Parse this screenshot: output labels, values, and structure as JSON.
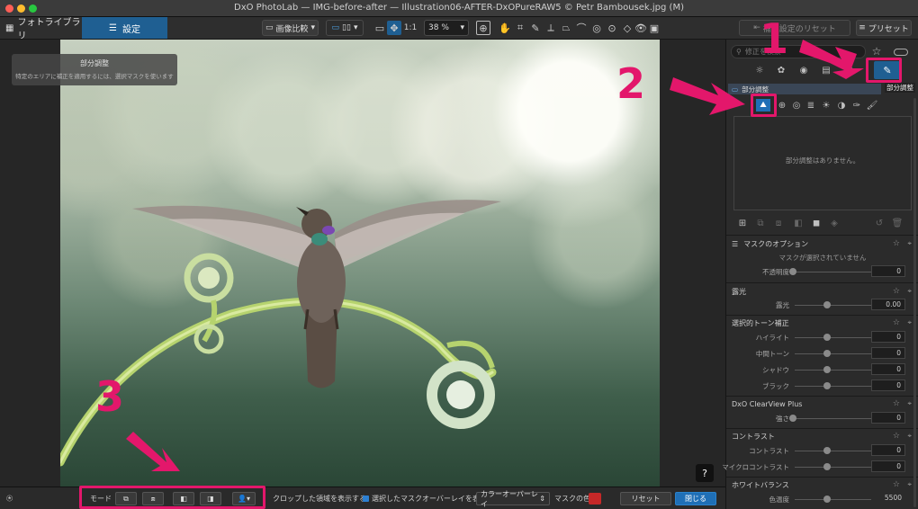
{
  "window": {
    "title": "DxO PhotoLab — IMG-before-after — Illustration06-AFTER-DxOPureRAW5 © Petr Bambousek.jpg (M)"
  },
  "tabs": {
    "library": "フォトライブラリ",
    "settings": "設定"
  },
  "toolbar": {
    "compare_label": "画像比較",
    "ratio_label": "1:1",
    "zoom_value": "38 %",
    "reset_corrections_label": "補正設定のリセット",
    "presets_label": "プリセット"
  },
  "mask_panel": {
    "title": "部分調整",
    "description": "特定のエリアに補正を適用するには、選択マスクを使います"
  },
  "help": "?",
  "right_panel": {
    "search_placeholder": "修正を検索",
    "active_tab_tooltip": "部分調整",
    "local_header": "部分調整",
    "empty_message": "部分調整はありません。",
    "mask_options": {
      "title": "マスクのオプション",
      "no_selection": "マスクが選択されていません",
      "opacity_label": "不透明度",
      "opacity_value": "0"
    },
    "exposure": {
      "title": "露光",
      "label": "露光",
      "value": "0.00"
    },
    "selective_tone": {
      "title": "選択的トーン補正",
      "items": [
        {
          "label": "ハイライト",
          "value": "0"
        },
        {
          "label": "中間トーン",
          "value": "0"
        },
        {
          "label": "シャドウ",
          "value": "0"
        },
        {
          "label": "ブラック",
          "value": "0"
        }
      ]
    },
    "clearview": {
      "title": "DxO ClearView Plus",
      "label": "強さ",
      "value": "0"
    },
    "contrast": {
      "title": "コントラスト",
      "items": [
        {
          "label": "コントラスト",
          "value": "0"
        },
        {
          "label": "マイクロコントラスト",
          "value": "0"
        }
      ]
    },
    "white_balance": {
      "title": "ホワイトバランス",
      "label": "色温度",
      "value": "5500"
    }
  },
  "bottom_bar": {
    "mode_label": "モード",
    "crop_label": "クロップした領域を表示する",
    "overlay_label": "選択したマスクオーバーレイを表示",
    "overlay_type": "カラーオーバーレイ",
    "mask_color_label": "マスクの色",
    "mask_color": "#c62828",
    "reset_label": "リセット",
    "close_label": "閉じる"
  },
  "annotations": {
    "n1": "1",
    "n2": "2",
    "n3": "3",
    "color": "#e3176b"
  }
}
